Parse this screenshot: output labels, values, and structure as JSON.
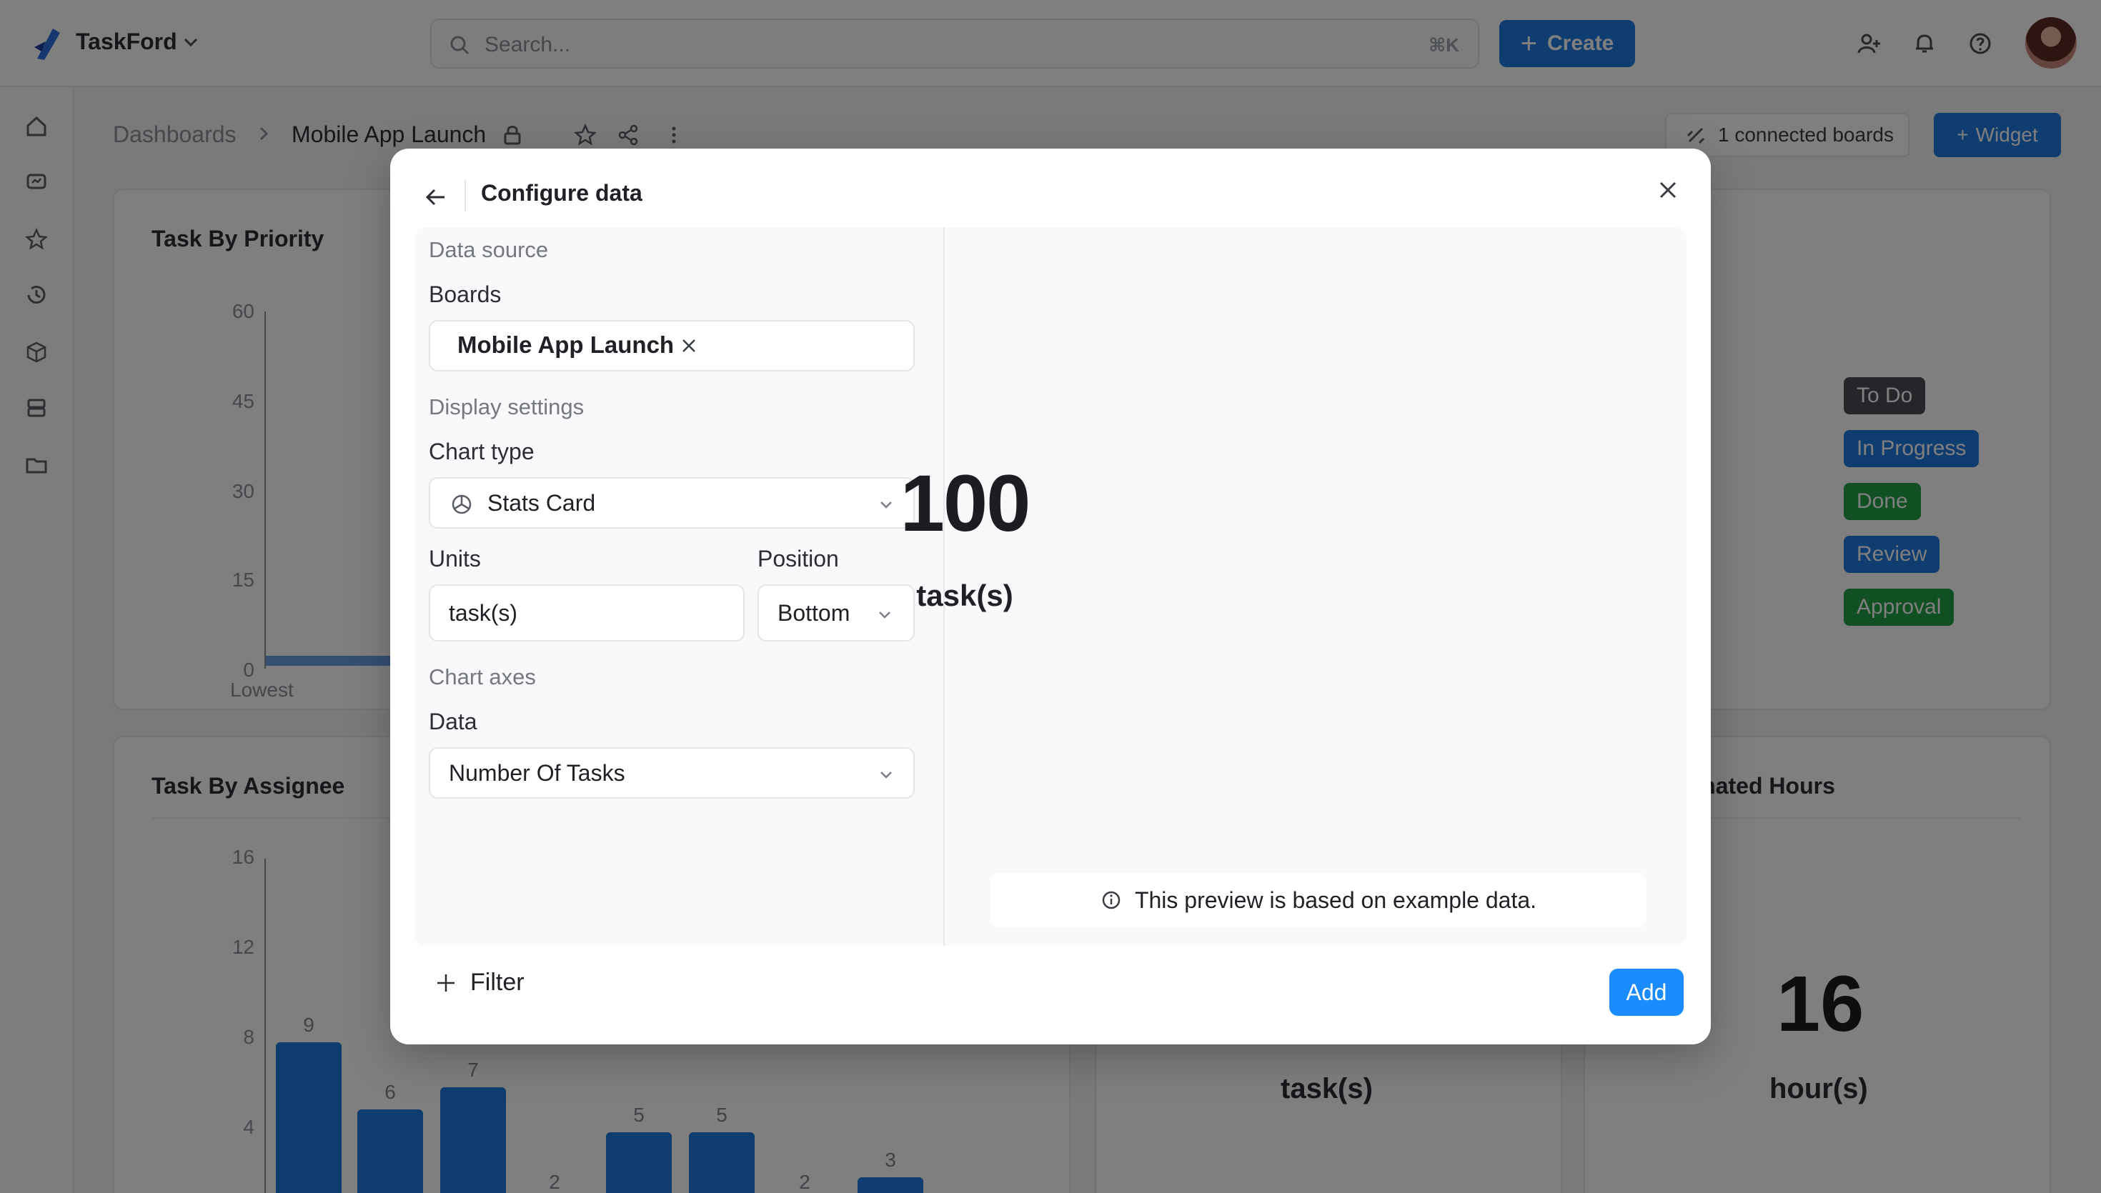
{
  "app": {
    "brand": "TaskFord",
    "search_placeholder": "Search...",
    "search_shortcut": "⌘K",
    "create_label": "Create"
  },
  "breadcrumb": {
    "root": "Dashboards",
    "current": "Mobile App Launch"
  },
  "dashboard": {
    "connected_boards": "1 connected boards",
    "widget_label": "Widget",
    "priority_card": {
      "title": "Task By Priority",
      "ticks": [
        "60",
        "45",
        "30",
        "15",
        "0"
      ],
      "first_category": "Lowest"
    },
    "assignee_card": {
      "title": "Task By Assignee",
      "ticks": [
        "16",
        "12",
        "8",
        "4"
      ],
      "bar_values": [
        9,
        6,
        7,
        2,
        5,
        5,
        2,
        3
      ]
    },
    "status_legend": [
      "To Do",
      "In Progress",
      "Done",
      "Review",
      "Approval"
    ],
    "status_colors": [
      "#4a4d55",
      "#1f7ae0",
      "#22a046",
      "#1f7ae0",
      "#22a046"
    ],
    "tasks_card": {
      "unit": "task(s)"
    },
    "hours_card": {
      "title": "al Estimated Hours",
      "value": "16",
      "unit": "hour(s)"
    }
  },
  "modal": {
    "title": "Configure data",
    "data_source_label": "Data source",
    "boards_label": "Boards",
    "board_chip": "Mobile App Launch",
    "display_settings_label": "Display settings",
    "chart_type_label": "Chart type",
    "chart_type_value": "Stats Card",
    "units_label": "Units",
    "units_value": "task(s)",
    "position_label": "Position",
    "position_value": "Bottom",
    "chart_axes_label": "Chart axes",
    "data_label": "Data",
    "data_value": "Number Of Tasks",
    "preview_number": "100",
    "preview_unit": "task(s)",
    "preview_note": "This preview is based on example data.",
    "filter_label": "Filter",
    "add_label": "Add"
  },
  "icons": {
    "back": "arrow-left-icon",
    "close": "close-icon",
    "chart_type": "pie-chart-icon",
    "info": "info-icon",
    "filter_plus": "plus-icon"
  },
  "colors": {
    "primary": "#1f7ae0",
    "add_button": "#1a8cff"
  }
}
